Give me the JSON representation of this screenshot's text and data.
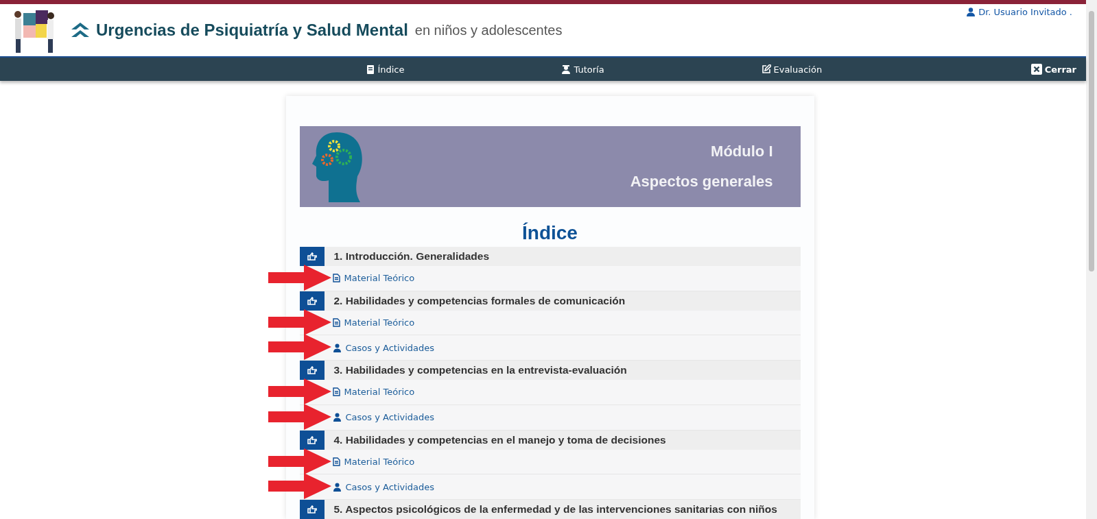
{
  "header": {
    "title": "Urgencias de Psiquiatría y Salud Mental",
    "subtitle": "en niños y adolescentes",
    "user": "Dr. Usuario Invitado ."
  },
  "nav": [
    {
      "label": "Índice",
      "kind": "book"
    },
    {
      "label": "Tutoría",
      "kind": "tutor"
    },
    {
      "label": "Evaluación",
      "kind": "edit"
    }
  ],
  "close": {
    "label": "Cerrar"
  },
  "banner": {
    "line1": "Módulo I",
    "line2": "Aspectos generales"
  },
  "index_title": "Índice",
  "sections": [
    {
      "title": "1. Introducción. Generalidades",
      "links": [
        {
          "kind": "document",
          "label": "Material Teórico",
          "highlighted": true
        }
      ]
    },
    {
      "title": "2. Habilidades y competencias formales de comunicación",
      "links": [
        {
          "kind": "document",
          "label": "Material Teórico",
          "highlighted": true
        },
        {
          "kind": "person",
          "label": "Casos y Actividades",
          "highlighted": true
        }
      ]
    },
    {
      "title": "3. Habilidades y competencias en la entrevista-evaluación",
      "links": [
        {
          "kind": "document",
          "label": "Material Teórico",
          "highlighted": true
        },
        {
          "kind": "person",
          "label": "Casos y Actividades",
          "highlighted": true
        }
      ]
    },
    {
      "title": "4. Habilidades y competencias en el manejo y toma de decisiones",
      "links": [
        {
          "kind": "document",
          "label": "Material Teórico",
          "highlighted": true
        },
        {
          "kind": "person",
          "label": "Casos y Actividades",
          "highlighted": true
        }
      ]
    },
    {
      "title": "5. Aspectos psicológicos de la enfermedad y de las intervenciones sanitarias con niños"
    }
  ]
}
